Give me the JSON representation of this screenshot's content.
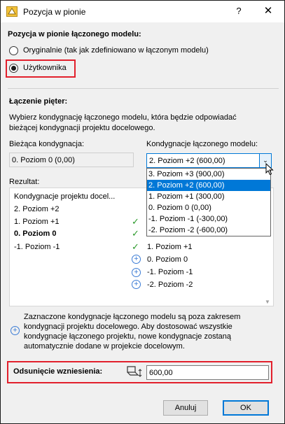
{
  "window": {
    "title": "Pozycja w pionie",
    "help_label": "?",
    "close_label": "✕"
  },
  "model_section": {
    "header": "Pozycja w pionie łączonego modelu:",
    "option_original": "Oryginalnie (tak jak zdefiniowano w łączonym modelu)",
    "option_user": "Użytkownika",
    "selected": "Użytkownika"
  },
  "stories": {
    "header": "Łączenie pięter:",
    "description_line1": "Wybierz kondygnację łączonego modelu, która będzie odpowiadać",
    "description_line2": "bieżącej kondygnacji projektu docelowego.",
    "current_label": "Bieżąca kondygnacja:",
    "current_value": "0. Poziom 0 (0,00)",
    "linked_label": "Kondygnacje łączonego modelu:",
    "linked_value": "2. Poziom +2 (600,00)",
    "dropdown_options": [
      "3. Poziom +3 (900,00)",
      "2. Poziom +2 (600,00)",
      "1. Poziom +1 (300,00)",
      "0. Poziom 0 (0,00)",
      "-1. Poziom -1 (-300,00)",
      "-2. Poziom -2 (-600,00)"
    ],
    "dropdown_selected": "2. Poziom +2 (600,00)"
  },
  "result": {
    "label": "Rezultat:",
    "column_header": "Kondygnacje projektu docel...",
    "left_rows": [
      "2. Poziom +2",
      "1. Poziom +1",
      "0. Poziom 0",
      "-1. Poziom -1"
    ],
    "right_rows": [
      "1. Poziom +1",
      "0. Poziom 0",
      "-1. Poziom -1",
      "-2. Poziom -2"
    ]
  },
  "note": {
    "line1": "Zaznaczone kondygnacje łączonego modelu są poza zakresem",
    "line2": "kondygnacji projektu docelowego. Aby dostosować wszystkie",
    "line3": "kondygnacje łączonego projektu, nowe kondygnacje zostaną",
    "line4": "automatycznie dodane w projekcie docelowym."
  },
  "offset": {
    "label": "Odsunięcie wzniesienia:",
    "value": "600,00"
  },
  "buttons": {
    "cancel": "Anuluj",
    "ok": "OK"
  },
  "colors": {
    "highlight": "#e2202c",
    "selection": "#0078d7",
    "check": "#2e9b2e",
    "plus": "#3a7bd5"
  }
}
